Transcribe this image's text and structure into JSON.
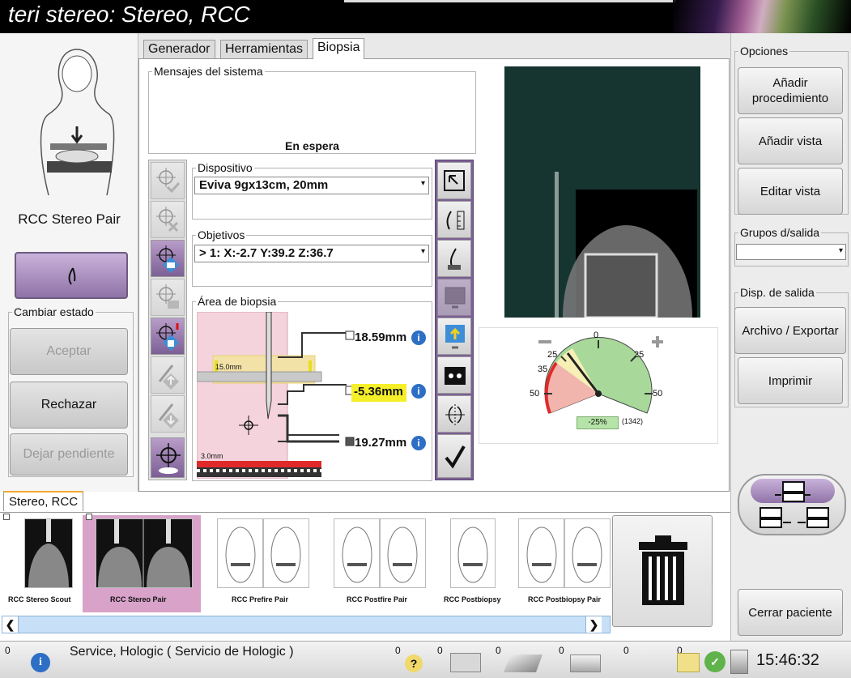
{
  "window": {
    "title": "teri stereo:  Stereo, RCC"
  },
  "left": {
    "view_name": "RCC Stereo Pair",
    "change_state_legend": "Cambiar estado",
    "accept": "Aceptar",
    "reject": "Rechazar",
    "pending": "Dejar pendiente"
  },
  "tabs": [
    "Generador",
    "Herramientas",
    "Biopsia"
  ],
  "biopsy": {
    "messages_legend": "Mensajes del sistema",
    "status": "En espera",
    "device_legend": "Dispositivo",
    "device_value": "Eviva 9gx13cm, 20mm",
    "targets_legend": "Objetivos",
    "targets_value": "> 1: X:-2.7  Y:39.2  Z:36.7",
    "area_legend": "Área de biopsia",
    "meas_1": "18.59mm",
    "meas_2": "-5.36mm",
    "meas_3": "19.27mm",
    "label_15": "15.0mm",
    "label_3": "3.0mm"
  },
  "gauge": {
    "minus": "−",
    "plus": "+",
    "t0": "0",
    "t25l": "25",
    "t25r": "25",
    "t35": "35",
    "t50l": "50",
    "t50r": "50",
    "percent": "-25%",
    "count": "(1342)"
  },
  "right": {
    "options_legend": "Opciones",
    "add_procedure": "Añadir procedimiento",
    "add_view": "Añadir vista",
    "edit_view": "Editar vista",
    "output_groups_legend": "Grupos d/salida",
    "output_devices_legend": "Disp. de salida",
    "archive_export": "Archivo / Exportar",
    "print": "Imprimir",
    "close_patient": "Cerrar paciente"
  },
  "bottom": {
    "tab": "Stereo, RCC",
    "thumbnails": [
      "RCC Stereo Scout",
      "RCC Stereo Pair",
      "RCC Prefire Pair",
      "RCC Postfire Pair",
      "RCC Postbiopsy",
      "RCC Postbiopsy Pair"
    ]
  },
  "status": {
    "c0": "0",
    "user": "Service, Hologic ( Servicio de Hologic )",
    "c1": "0",
    "c2": "0",
    "c3": "0",
    "c4": "0",
    "c5": "0",
    "c6": "0",
    "time": "15:46:32"
  }
}
